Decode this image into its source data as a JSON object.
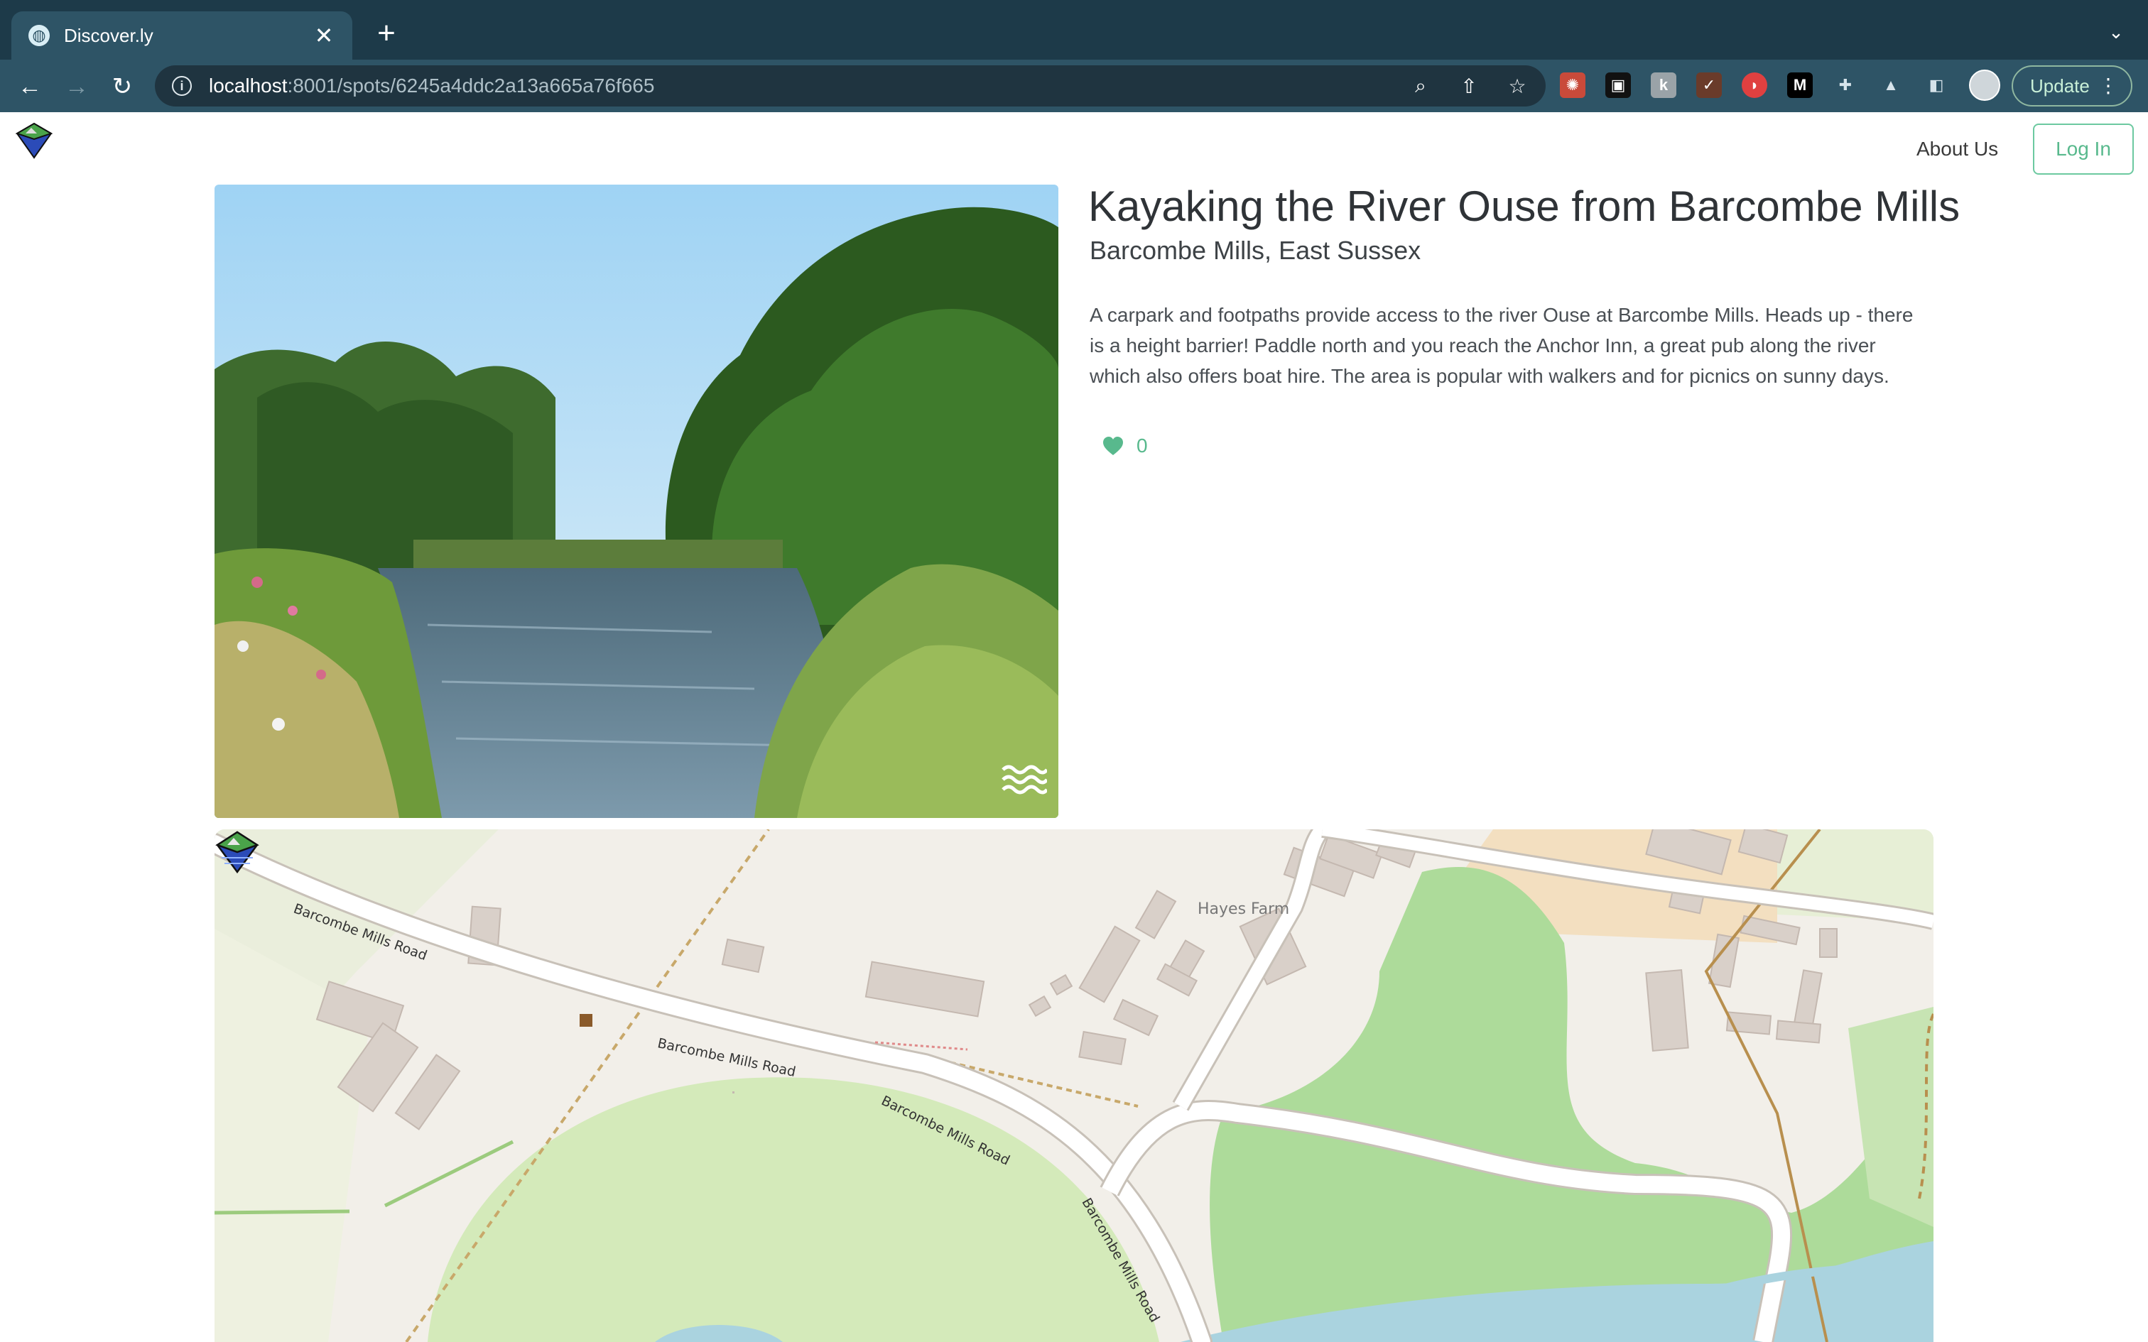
{
  "browser": {
    "tab_title": "Discover.ly",
    "new_tab_symbol": "+",
    "close_symbol": "✕",
    "url_host": "localhost",
    "url_path": ":8001/spots/6245a4ddc2a13a665a76f665",
    "update_label": "Update",
    "icons": [
      "back-arrow-icon",
      "forward-arrow-icon",
      "reload-icon",
      "info-icon",
      "zoom-icon",
      "share-icon",
      "star-icon",
      "extensions-icon",
      "sidebar-icon",
      "kebab-menu-icon"
    ],
    "colors": {
      "tab_strip": "#1d3a49",
      "toolbar": "#2e5466",
      "omnibox": "#1f3440"
    }
  },
  "site": {
    "nav": {
      "about_label": "About Us",
      "login_label": "Log In"
    },
    "accent_color": "#58b98d"
  },
  "spot": {
    "title": "Kayaking the River Ouse from Barcombe Mills",
    "location": "Barcombe Mills, East Sussex",
    "description": "A carpark and footpaths provide access to the river Ouse at Barcombe Mills. Heads up - there is a height barrier! Paddle north and you reach the Anchor Inn, a great pub along the river which also offers boat hire. The area is popular with walkers and for picnics on sunny days.",
    "likes": "0",
    "category_icon": "water-waves-icon"
  },
  "map": {
    "road_labels": [
      "Barcombe Mills Road",
      "Barcombe Mills Road",
      "Barcombe Mills Road",
      "Barcombe Mills Road"
    ],
    "place_label": "Hayes Farm"
  }
}
